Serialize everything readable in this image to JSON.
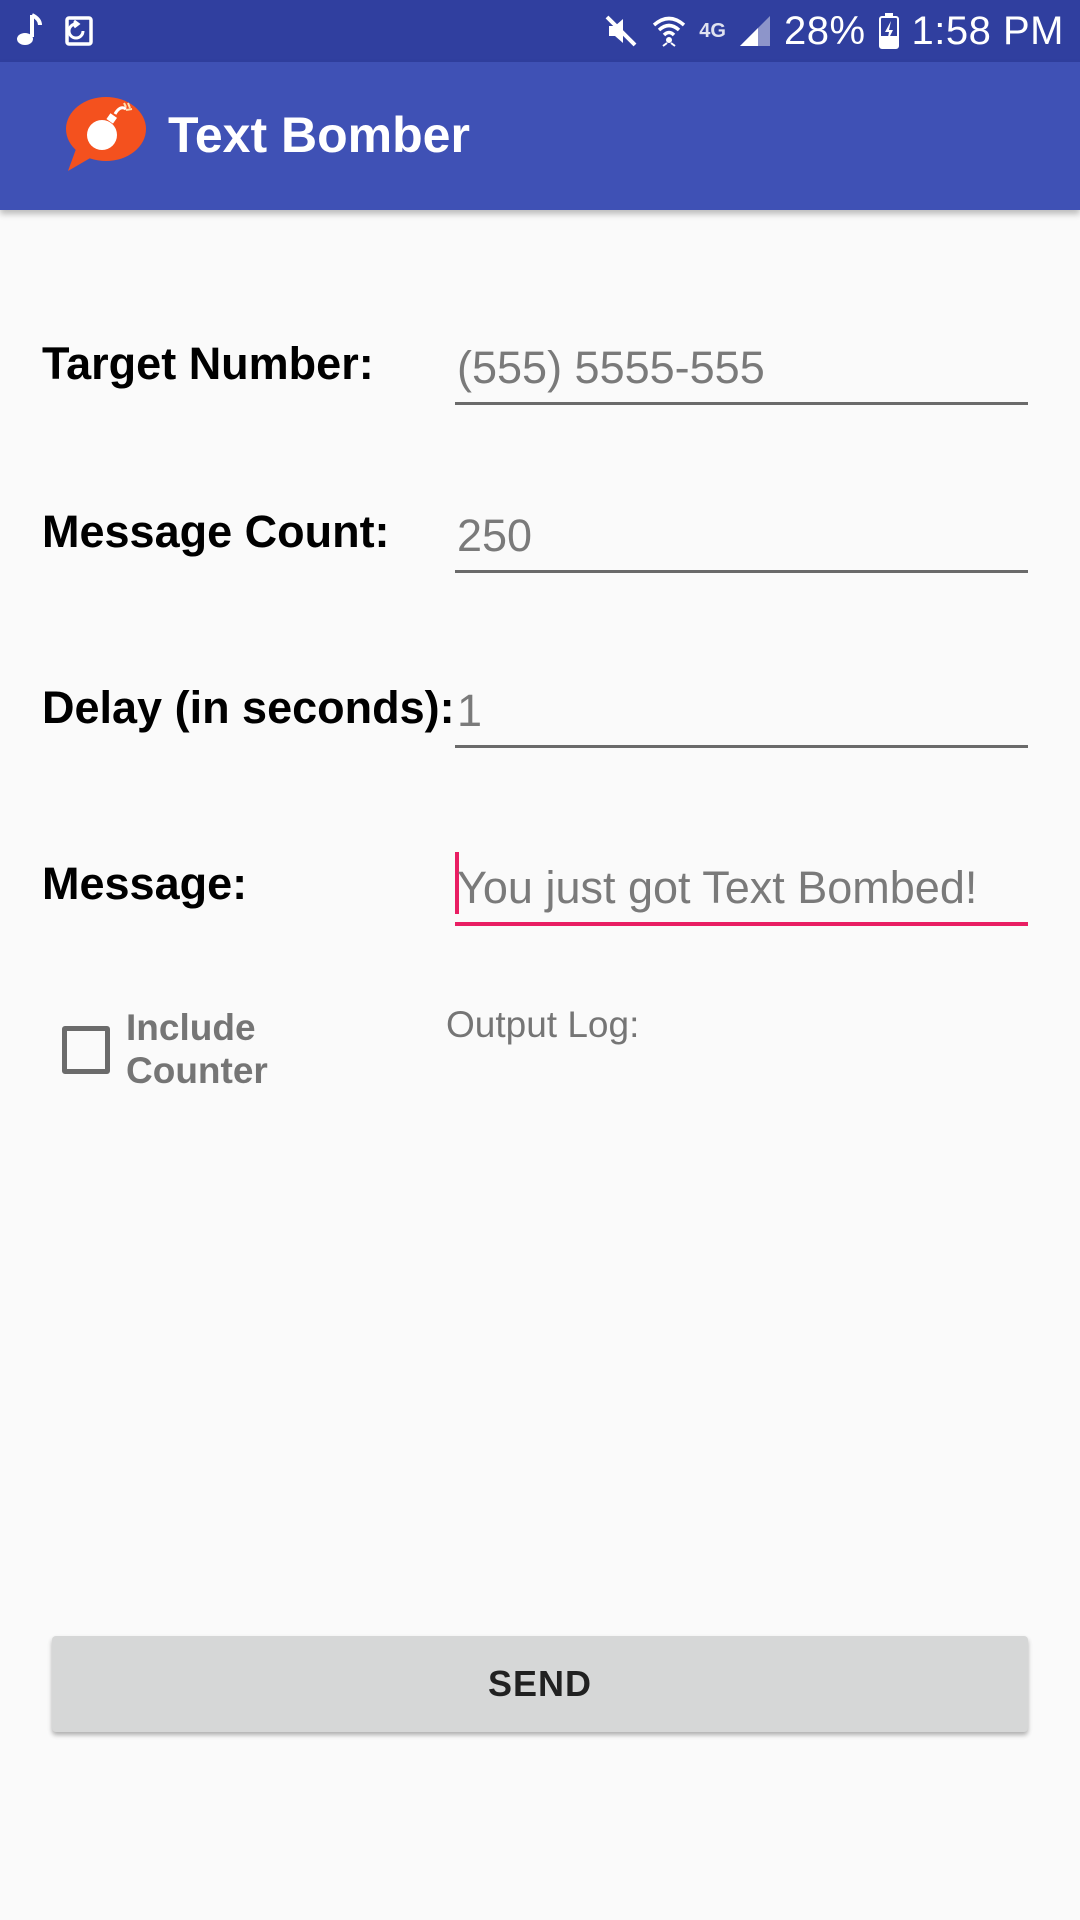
{
  "status_bar": {
    "left_icons": [
      "music-note-icon",
      "sync-calendar-icon"
    ],
    "right_icons": [
      "mute-icon",
      "wifi-icon",
      "signal-icon",
      "battery-charging-icon"
    ],
    "network_type": "4G",
    "battery": "28%",
    "time": "1:58 PM"
  },
  "app_bar": {
    "title": "Text Bomber",
    "logo_icon": "bomb-chat-bubble-icon"
  },
  "form": {
    "target_number": {
      "label": "Target Number:",
      "value": "(555) 5555-555"
    },
    "message_count": {
      "label": "Message Count:",
      "value": "250"
    },
    "delay": {
      "label": "Delay (in seconds):",
      "value": "1"
    },
    "message": {
      "label": "Message:",
      "value": "You just got Text Bombed!"
    }
  },
  "options": {
    "include_counter_label": "Include Counter",
    "include_counter_checked": false
  },
  "output_log_label": "Output Log:",
  "send_button_label": "SEND",
  "colors": {
    "status_bar": "#303f9f",
    "app_bar": "#3f51b5",
    "accent": "#e91e63",
    "logo": "#f4511e"
  }
}
